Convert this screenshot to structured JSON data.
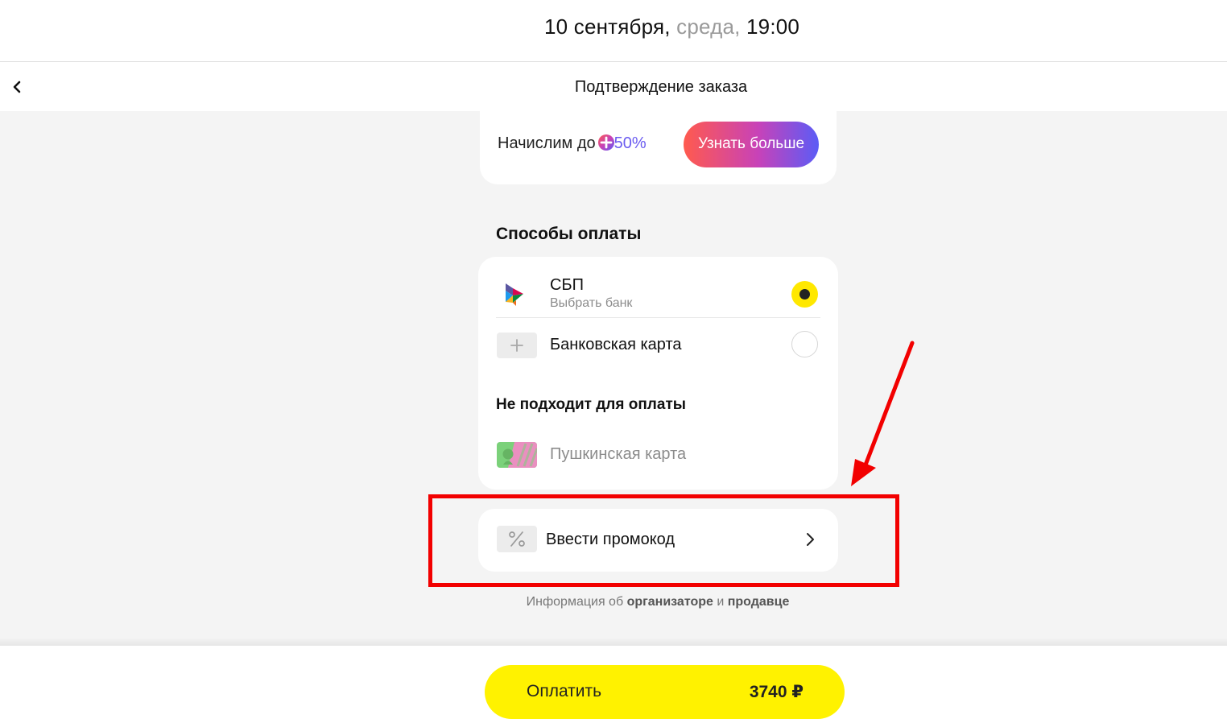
{
  "header": {
    "date": "10 сентября,",
    "weekday": "среда,",
    "time": "19:00"
  },
  "nav": {
    "title": "Подтверждение заказа",
    "back_icon": "chevron-left-icon"
  },
  "plus_banner": {
    "text": "Начислим до",
    "percent": "50%",
    "icon": "plus-points-icon",
    "button_label": "Узнать больше"
  },
  "payment": {
    "section_title": "Способы оплаты",
    "methods": [
      {
        "name": "СБП",
        "subtitle": "Выбрать банк",
        "icon": "sbp-logo-icon",
        "selected": true
      },
      {
        "name": "Банковская карта",
        "icon": "add-card-icon",
        "selected": false
      }
    ],
    "not_suitable_title": "Не подходит для оплаты",
    "not_suitable": [
      {
        "name": "Пушкинская карта",
        "icon": "pushkin-card-icon"
      }
    ]
  },
  "promo": {
    "label": "Ввести промокод",
    "icon": "percent-icon",
    "chevron": "chevron-right-icon"
  },
  "info": {
    "prefix": "Информация об",
    "organizer": "организаторе",
    "conj": "и",
    "seller": "продавце"
  },
  "pay_button": {
    "label": "Оплатить",
    "amount": "3740 ₽"
  },
  "annotation": {
    "highlight_color": "#f20000"
  },
  "colors": {
    "accent_yellow": "#fff200",
    "background": "#f4f4f4"
  }
}
